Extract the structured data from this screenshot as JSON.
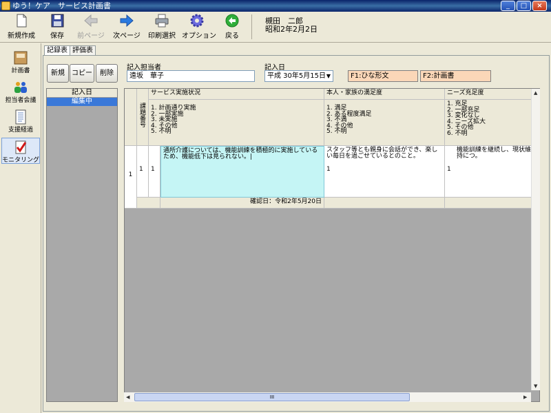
{
  "window": {
    "title": "ゆう！ケア　サービス計画書",
    "min_symbol": "_",
    "max_symbol": "□",
    "close_symbol": "×"
  },
  "toolbar": {
    "new_create": "新規作成",
    "save": "保存",
    "prev_page": "前ページ",
    "next_page": "次ページ",
    "print_select": "印刷選択",
    "options": "オプション",
    "back": "戻る"
  },
  "user": {
    "name": "槻田　二郎",
    "date": "昭和2年2月2日"
  },
  "leftnav": {
    "items": [
      {
        "label": "計画書",
        "icon": "planbook-icon"
      },
      {
        "label": "担当者会議",
        "icon": "people-icon"
      },
      {
        "label": "支援経過",
        "icon": "notebook-icon"
      },
      {
        "label": "モニタリング",
        "icon": "checklist-icon"
      }
    ]
  },
  "tabs": [
    "記録表",
    "評価表"
  ],
  "actions": {
    "new": "新規",
    "copy": "コピー",
    "delete": "削除"
  },
  "form": {
    "author_label": "記入担当者",
    "author_value": "遠坂　華子",
    "date_label": "記入日",
    "date_value": "平成 30年5月15日",
    "f1": "F1:ひな形文",
    "f2": "F2:計画書"
  },
  "datelist": {
    "header": "記入日",
    "selected": "編集中"
  },
  "grid": {
    "issue_no_header": "課題番号",
    "columns": [
      {
        "header": "サービス実施状況",
        "options": [
          "1. 計画通り実施",
          "2. 一部実施",
          "3. 未実施",
          "4. その他",
          "5. 不明"
        ]
      },
      {
        "header": "本人・家族の満足度",
        "options": [
          "1. 満足",
          "2. ある程度満足",
          "3. 不満",
          "4. その他",
          "5. 不明"
        ]
      },
      {
        "header": "ニーズ充足度",
        "options": [
          "1. 充足",
          "2. 一部充足",
          "3. 変化なし",
          "4. ニーズ拡大",
          "5. その他",
          "6. 不明"
        ]
      }
    ],
    "row": {
      "row_no": "1",
      "issue_no": "1",
      "service_code": "1",
      "service_text": "通所介護については、機能訓練を積極的に実施しているため、機能低下は見られない。|",
      "satisfaction_text": "スタッフ等とも親身に会話ができ、楽しい毎日を過ごせているとのこと。",
      "satisfaction_code": "1",
      "needs_text": "機能訓練を継続し、現状維持につ。",
      "needs_code": "1",
      "confirm": "確認日：令和2年5月20日"
    },
    "hscroll_grip": "III"
  },
  "colors": {
    "selected_cell": "#c5f5f5",
    "fkey_bg": "#fbd7b8",
    "selected_row": "#3a78d8"
  }
}
